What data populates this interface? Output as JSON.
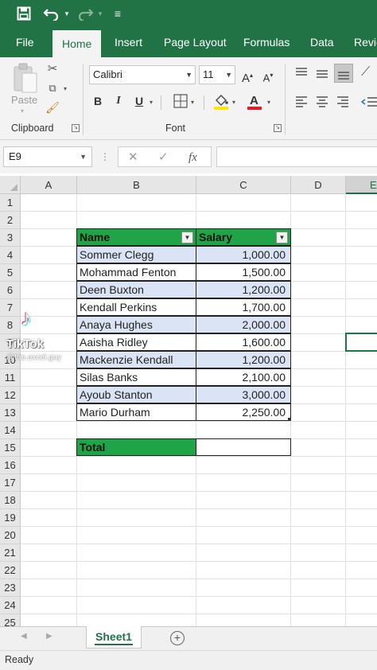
{
  "qat": {
    "save_icon": "save-icon",
    "undo_icon": "undo-icon",
    "redo_icon": "redo-icon",
    "customize_icon": "customize-qat-icon"
  },
  "tabs": [
    {
      "label": "File"
    },
    {
      "label": "Home"
    },
    {
      "label": "Insert"
    },
    {
      "label": "Page Layout"
    },
    {
      "label": "Formulas"
    },
    {
      "label": "Data"
    },
    {
      "label": "Revie"
    }
  ],
  "ribbon": {
    "clipboard": {
      "label": "Clipboard",
      "paste_label": "Paste"
    },
    "font": {
      "label": "Font",
      "font_name": "Calibri",
      "font_size": "11",
      "bold": "B",
      "italic": "I",
      "underline": "U"
    }
  },
  "formula_bar": {
    "name_box": "E9",
    "fx": "fx",
    "formula": ""
  },
  "grid": {
    "columns": [
      "A",
      "B",
      "C",
      "D",
      "E"
    ],
    "rows": [
      "1",
      "2",
      "3",
      "4",
      "5",
      "6",
      "7",
      "8",
      "9",
      "10",
      "11",
      "12",
      "13",
      "14",
      "15",
      "16",
      "17",
      "18",
      "19",
      "20",
      "21",
      "22",
      "23",
      "24",
      "25"
    ]
  },
  "table": {
    "headers": [
      "Name",
      "Salary"
    ],
    "rows": [
      {
        "name": "Sommer Clegg",
        "salary": "1,000.00"
      },
      {
        "name": "Mohammad Fenton",
        "salary": "1,500.00"
      },
      {
        "name": "Deen Buxton",
        "salary": "1,200.00"
      },
      {
        "name": "Kendall Perkins",
        "salary": "1,700.00"
      },
      {
        "name": "Anaya Hughes",
        "salary": "2,000.00"
      },
      {
        "name": "Aaisha Ridley",
        "salary": "1,600.00"
      },
      {
        "name": "Mackenzie Kendall",
        "salary": "1,200.00"
      },
      {
        "name": "Silas Banks",
        "salary": "2,100.00"
      },
      {
        "name": "Ayoub Stanton",
        "salary": "3,000.00"
      },
      {
        "name": "Mario Durham",
        "salary": "2,250.00"
      }
    ],
    "total_label": "Total",
    "total_value": ""
  },
  "watermark": {
    "brand": "TikTok",
    "user": "@the.excel.guy"
  },
  "sheets": [
    {
      "name": "Sheet1"
    }
  ],
  "status": {
    "text": "Ready"
  },
  "colors": {
    "excel_green": "#217346",
    "header_green": "#1fa547",
    "band_blue": "#dbe4f5"
  }
}
